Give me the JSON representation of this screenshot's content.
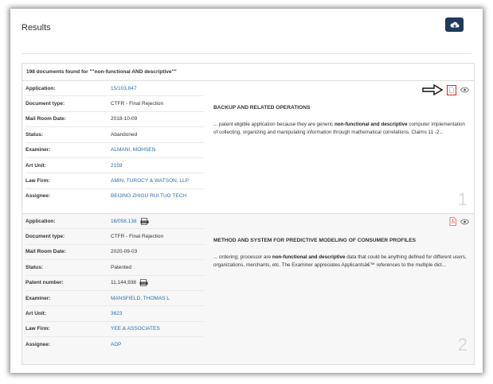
{
  "header": {
    "title": "Results",
    "download_icon": "cloud-download-icon"
  },
  "count_text": "198 documents found for \"\"non-functional AND descriptive\"\"",
  "labels": {
    "application": "Application:",
    "document_type": "Document type:",
    "mail_room_date": "Mail Room Date:",
    "status": "Status:",
    "patent_number": "Patent number:",
    "examiner": "Examiner:",
    "art_unit": "Art Unit:",
    "law_firm": "Law Firm:",
    "assignee": "Assignee:"
  },
  "results": [
    {
      "index": "1",
      "application": "15/103,847",
      "document_type": "CTFR - Final Rejection",
      "mail_room_date": "2018-10-09",
      "status": "Abandoned",
      "examiner": "ALMANI, MOHSEN",
      "art_unit": "2159",
      "law_firm": "AMIN, TUROCY & WATSON, LLP",
      "assignee": "BEIJING ZHIGU RUI TUO TECH",
      "title": "BACKUP AND RELATED OPERATIONS",
      "snippet_pre": "... patent eligible application because they are generic ",
      "snippet_bold": "non-functional and descriptive",
      "snippet_post": " computer implementation of collecting, organizing and manipulating information through mathematical correlations. Claims 11 -2..."
    },
    {
      "index": "2",
      "application": "16/058,138",
      "document_type": "CTFR - Final Rejection",
      "mail_room_date": "2020-09-03",
      "status": "Patented",
      "patent_number": "11,144,938",
      "examiner": "MANSFIELD, THOMAS L",
      "art_unit": "3623",
      "law_firm": "YEE & ASSOCIATES",
      "assignee": "ADP",
      "title": "METHOD AND SYSTEM FOR PREDICTIVE MODELING OF CONSUMER PROFILES",
      "snippet_pre": "... ordering; processor are ",
      "snippet_bold": "non-functional and descriptive",
      "snippet_post": " data that could be anything defined for different users, organizations, merchants, etc. The Examiner appreciates Applicantsâ€™ references to the multiple dict..."
    }
  ],
  "colors": {
    "link": "#2a6fb0",
    "button": "#1f3a5a",
    "highlight": "#e02020",
    "pdf": "#e05a4a"
  }
}
